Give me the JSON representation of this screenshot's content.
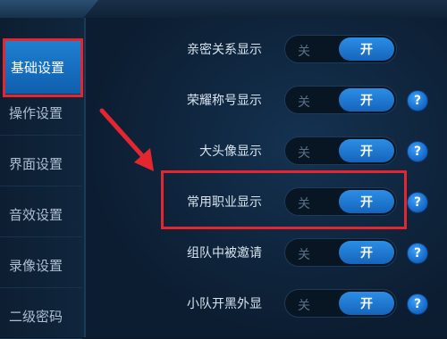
{
  "sidebar": {
    "items": [
      {
        "label": "基础设置",
        "active": true
      },
      {
        "label": "操作设置"
      },
      {
        "label": "界面设置"
      },
      {
        "label": "音效设置"
      },
      {
        "label": "录像设置"
      },
      {
        "label": "二级密码"
      }
    ]
  },
  "settings": [
    {
      "label": "亲密关系显示",
      "off": "关",
      "on": "开",
      "help": false,
      "selected": "开"
    },
    {
      "label": "荣耀称号显示",
      "off": "关",
      "on": "开",
      "help": true,
      "selected": "开"
    },
    {
      "label": "大头像显示",
      "off": "关",
      "on": "开",
      "help": true,
      "selected": "开"
    },
    {
      "label": "常用职业显示",
      "off": "关",
      "on": "开",
      "help": true,
      "selected": "开"
    },
    {
      "label": "组队中被邀请",
      "off": "关",
      "on": "开",
      "help": true,
      "selected": "开"
    },
    {
      "label": "小队开黑外显",
      "off": "关",
      "on": "开",
      "help": true,
      "selected": "开"
    }
  ],
  "help_glyph": "?",
  "colors": {
    "accent": "#1f7fd0",
    "highlight": "#e3262f"
  }
}
